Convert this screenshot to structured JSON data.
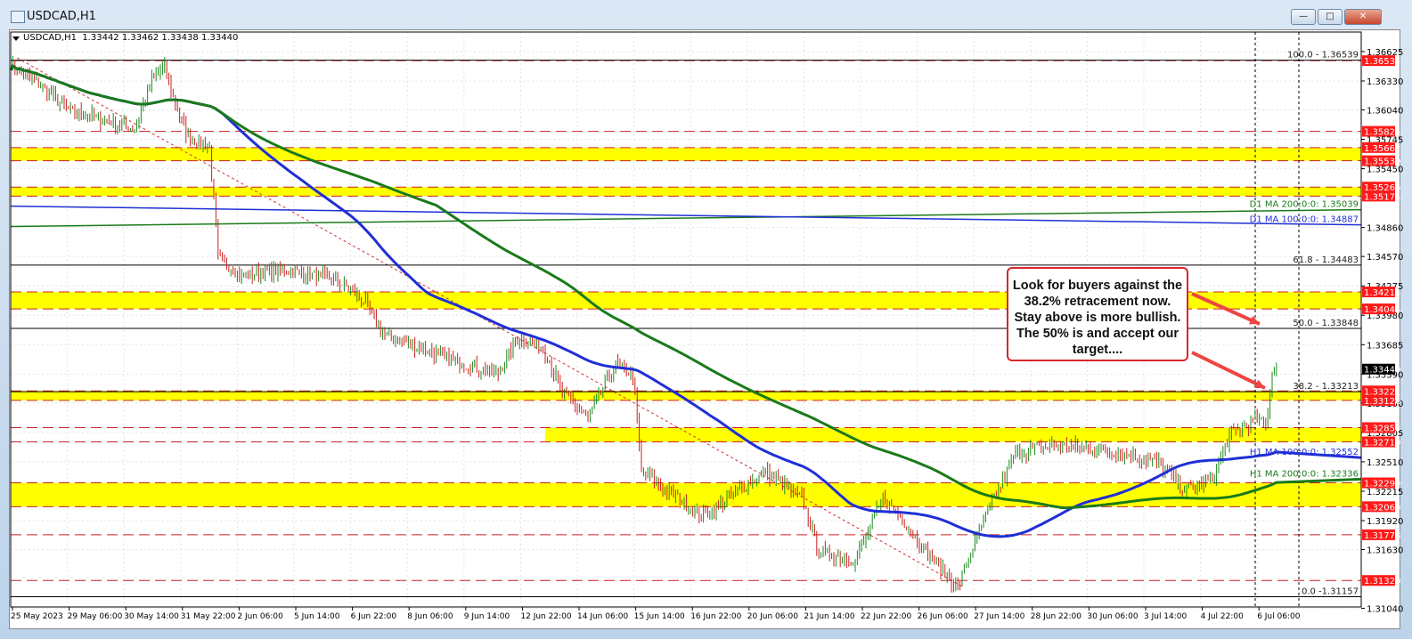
{
  "window": {
    "title": "USDCAD,H1",
    "buttons": {
      "minimize": "—",
      "maximize": "□",
      "close": "✕"
    }
  },
  "header": {
    "symbol": "USDCAD,H1",
    "open": "1.33442",
    "high": "1.33462",
    "low": "1.33438",
    "close": "1.33440"
  },
  "annotation": {
    "lines": [
      "Look for buyers against the",
      "38.2% retracement now.",
      "Stay above is more bullish.",
      "The 50% is and accept our",
      "target...."
    ]
  },
  "chart_data": {
    "type": "candlestick",
    "title": "USDCAD,H1",
    "ylim": [
      1.3104,
      1.3668
    ],
    "y_ticks": [
      "1.36625",
      "1.36330",
      "1.36040",
      "1.35745",
      "1.35450",
      "1.34860",
      "1.34570",
      "1.34275",
      "1.33980",
      "1.33685",
      "1.33390",
      "1.33100",
      "1.32805",
      "1.32510",
      "1.32215",
      "1.31920",
      "1.31630",
      "1.31040"
    ],
    "x_labels": [
      "25 May 2023",
      "29 May 06:00",
      "30 May 14:00",
      "31 May 22:00",
      "2 Jun 06:00",
      "5 Jun 14:00",
      "6 Jun 22:00",
      "8 Jun 06:00",
      "9 Jun 14:00",
      "12 Jun 22:00",
      "14 Jun 06:00",
      "15 Jun 14:00",
      "16 Jun 22:00",
      "20 Jun 06:00",
      "21 Jun 14:00",
      "22 Jun 22:00",
      "26 Jun 06:00",
      "27 Jun 14:00",
      "28 Jun 22:00",
      "30 Jun 06:00",
      "3 Jul 14:00",
      "4 Jul 22:00",
      "6 Jul 06:00"
    ],
    "current_price": "1.33440",
    "price_path": [
      [
        0,
        1.365
      ],
      [
        1,
        1.36473
      ],
      [
        16,
        1.3625
      ],
      [
        28,
        1.36026
      ],
      [
        45,
        1.35937
      ],
      [
        58,
        1.35848
      ],
      [
        66,
        1.36339
      ],
      [
        72,
        1.36473
      ],
      [
        76,
        1.3616
      ],
      [
        83,
        1.35759
      ],
      [
        93,
        1.35669
      ],
      [
        97,
        1.34554
      ],
      [
        108,
        1.34375
      ],
      [
        120,
        1.3442
      ],
      [
        133,
        1.3442
      ],
      [
        153,
        1.3433
      ],
      [
        166,
        1.34107
      ],
      [
        174,
        1.33795
      ],
      [
        191,
        1.33661
      ],
      [
        212,
        1.33482
      ],
      [
        228,
        1.33393
      ],
      [
        237,
        1.3375
      ],
      [
        249,
        1.33661
      ],
      [
        258,
        1.33214
      ],
      [
        270,
        1.32947
      ],
      [
        283,
        1.33482
      ],
      [
        291,
        1.33393
      ],
      [
        295,
        1.32411
      ],
      [
        312,
        1.32143
      ],
      [
        324,
        1.31965
      ],
      [
        341,
        1.32233
      ],
      [
        353,
        1.32411
      ],
      [
        370,
        1.32143
      ],
      [
        378,
        1.31608
      ],
      [
        395,
        1.31518
      ],
      [
        408,
        1.32143
      ],
      [
        416,
        1.31965
      ],
      [
        428,
        1.31608
      ],
      [
        443,
        1.31251
      ],
      [
        449,
        1.31608
      ],
      [
        458,
        1.32054
      ],
      [
        470,
        1.3259
      ],
      [
        487,
        1.32679
      ],
      [
        508,
        1.32634
      ],
      [
        520,
        1.3259
      ],
      [
        537,
        1.325
      ],
      [
        549,
        1.32233
      ],
      [
        562,
        1.32322
      ],
      [
        570,
        1.32768
      ],
      [
        583,
        1.32947
      ],
      [
        587,
        1.32857
      ],
      [
        590,
        1.33393
      ],
      [
        592,
        1.3344
      ]
    ],
    "levels": [
      "1.36534",
      "1.35825",
      "1.35662",
      "1.35530",
      "1.35266",
      "1.35175",
      "1.34214",
      "1.34044",
      "1.33221",
      "1.33126",
      "1.32853",
      "1.32710",
      "1.32299",
      "1.32060",
      "1.31778",
      "1.31320"
    ],
    "zones": [
      [
        1.35662,
        1.3553,
        "full"
      ],
      [
        1.35266,
        1.35175,
        "full"
      ],
      [
        1.34214,
        1.34044,
        "full"
      ],
      [
        1.33221,
        1.33126,
        "full"
      ],
      [
        1.32853,
        1.3271,
        "partial"
      ],
      [
        1.32299,
        1.3206,
        "full"
      ]
    ],
    "fibonacci": [
      {
        "label": "100.0 - 1.36539",
        "price": 1.36539
      },
      {
        "label": "61.8 - 1.34483",
        "price": 1.34483
      },
      {
        "label": "50.0 - 1.33848",
        "price": 1.33848
      },
      {
        "label": "38.2 - 1.33213",
        "price": 1.33213
      },
      {
        "label": "0.0 -1.31157",
        "price": 1.31157
      }
    ],
    "moving_averages": [
      {
        "label": "D1 MA 200:0:0: 1.35039",
        "color": "#1a7a1a",
        "start": 1.3487,
        "end": 1.35039,
        "type": "daily"
      },
      {
        "label": "D1 MA 100:0:0: 1.34887",
        "color": "#1f2fd6",
        "start": 1.35075,
        "end": 1.34887,
        "type": "daily"
      },
      {
        "label": "H1 MA 100:0:0: 1.32552",
        "color": "#1f2fd6",
        "period": 100,
        "type": "hourly"
      },
      {
        "label": "H1 MA 200:0:0: 1.32336",
        "color": "#1a7a1a",
        "period": 200,
        "type": "hourly"
      }
    ],
    "trendline": [
      [
        3,
        1.36562
      ],
      [
        445,
        1.3126
      ]
    ],
    "colors": {
      "up": "#1a8a1a",
      "down": "#cc1f1f",
      "zone": "#ffff00",
      "level": "#cc1f1f",
      "label_bg": "#ff1a1a",
      "arrow": "#ee4444"
    }
  }
}
